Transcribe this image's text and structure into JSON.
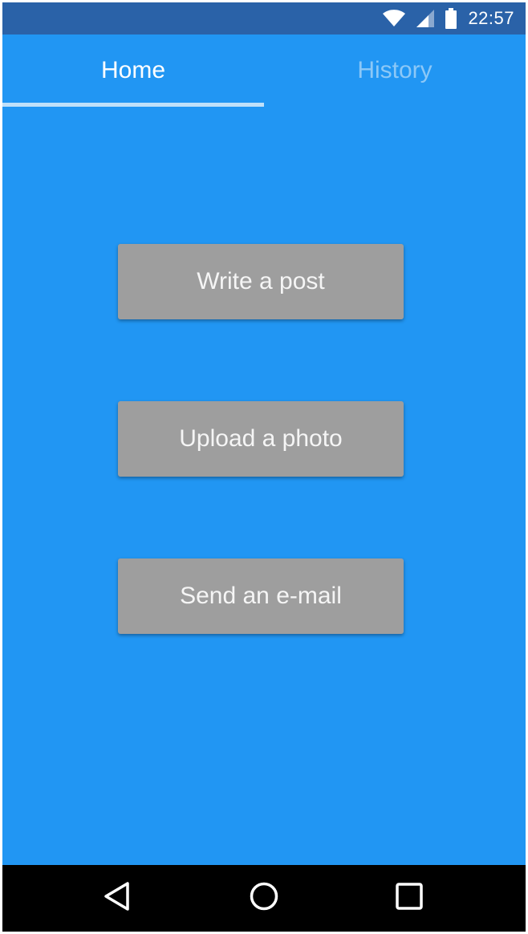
{
  "status_bar": {
    "time": "22:57",
    "icons": [
      "wifi-icon",
      "cellular-signal-icon",
      "battery-icon"
    ]
  },
  "tabs": [
    {
      "label": "Home",
      "selected": true
    },
    {
      "label": "History",
      "selected": false
    }
  ],
  "actions": [
    {
      "label": "Write a post"
    },
    {
      "label": "Upload a photo"
    },
    {
      "label": "Send an e-mail"
    }
  ],
  "navigation": {
    "icons": [
      "back-icon",
      "home-icon",
      "recent-apps-icon"
    ]
  },
  "colors": {
    "primary": "#2196F3",
    "status_bar": "#2A62A8",
    "button": "#9E9E9E",
    "tab_inactive_text": "#8CC8F7",
    "tab_indicator": "#BFE0FA",
    "nav_bar": "#000000"
  }
}
